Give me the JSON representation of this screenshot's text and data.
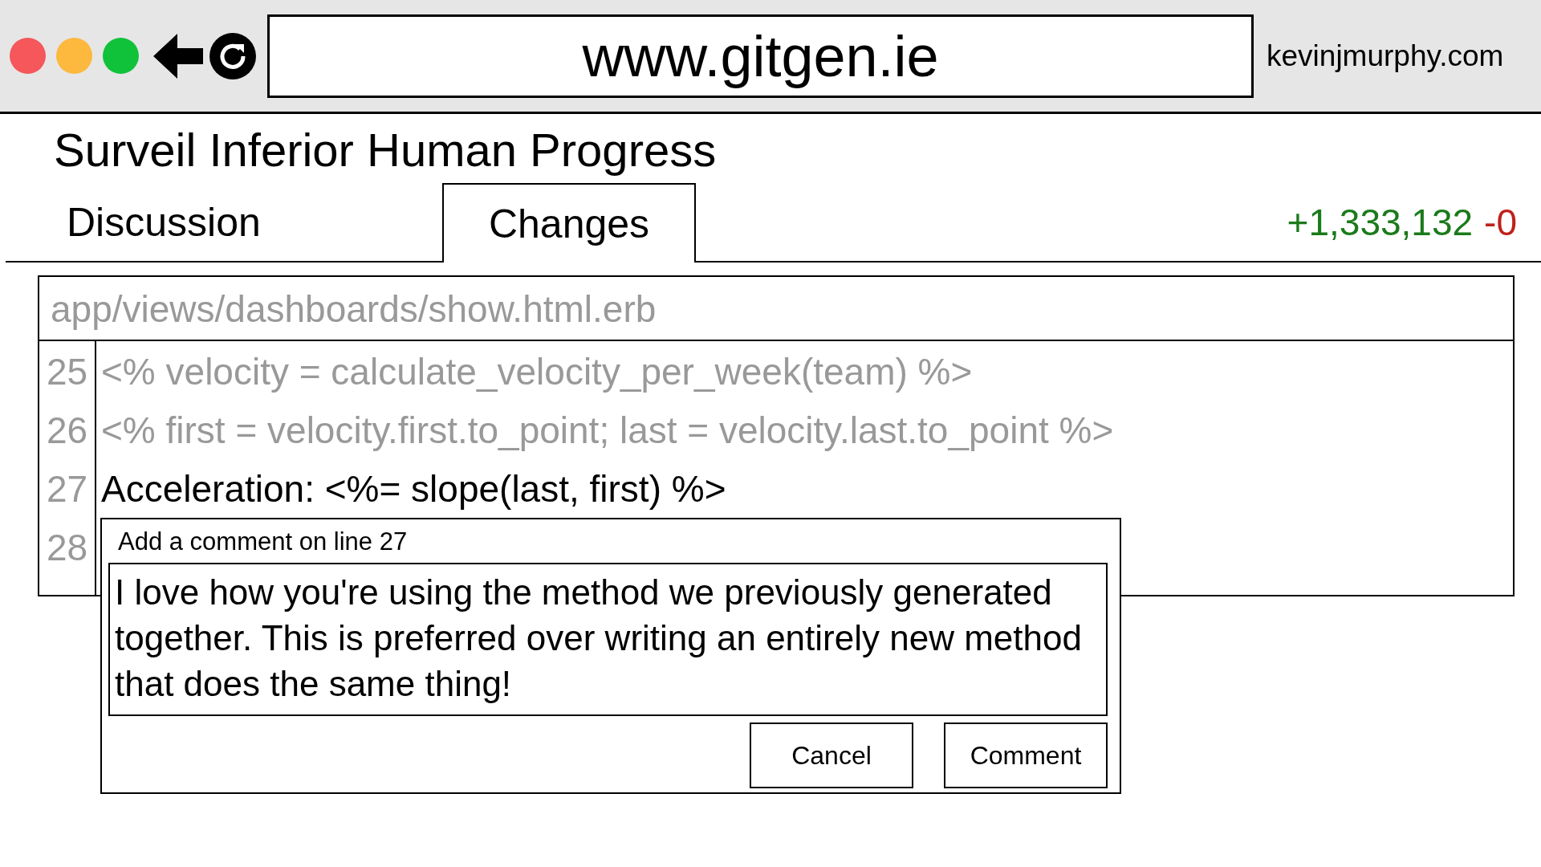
{
  "browser": {
    "url": "www.gitgen.ie",
    "credit": "kevinjmurphy.com"
  },
  "title": "Surveil Inferior Human Progress",
  "tabs": [
    {
      "label": "Discussion",
      "selected": false
    },
    {
      "label": "Changes",
      "selected": true
    }
  ],
  "diff_stats": {
    "additions": "+1,333,132",
    "deletions": "-0"
  },
  "file": {
    "path": "app/views/dashboards/show.html.erb",
    "lines": [
      {
        "number": "25",
        "text": "<% velocity = calculate_velocity_per_week(team) %>",
        "selected": false
      },
      {
        "number": "26",
        "text": "<% first = velocity.first.to_point; last = velocity.last.to_point %>",
        "selected": false
      },
      {
        "number": "27",
        "text": "Acceleration: <%= slope(last, first) %>",
        "selected": true
      },
      {
        "number": "28"
      }
    ]
  },
  "comment_box": {
    "label": "Add a comment on line 27",
    "value": "I love how you're using the method we previously generated together. This is preferred over writing an entirely new method that does the same thing!",
    "buttons": [
      "Cancel",
      "Comment"
    ]
  }
}
